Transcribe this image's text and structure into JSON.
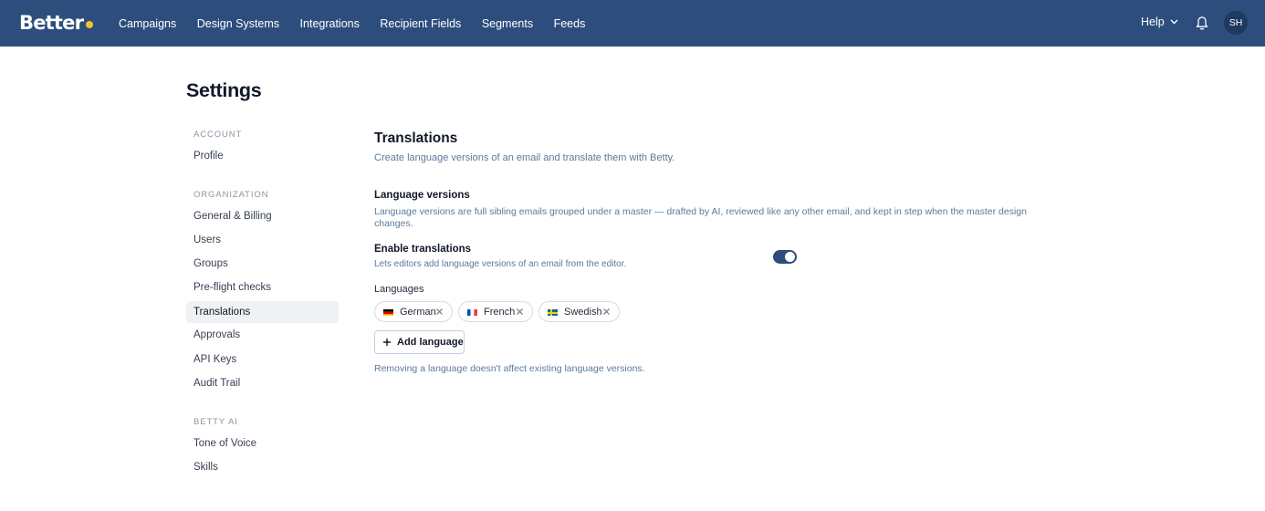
{
  "brand": {
    "name": "Better",
    "dot_color": "#f5c02b",
    "bar_color": "#2d4e7d"
  },
  "nav": [
    {
      "label": "Campaigns"
    },
    {
      "label": "Design Systems"
    },
    {
      "label": "Integrations"
    },
    {
      "label": "Recipient Fields"
    },
    {
      "label": "Segments"
    },
    {
      "label": "Feeds"
    }
  ],
  "header": {
    "help_label": "Help",
    "help_icon": "chevron-down-icon",
    "bell_icon": "bell-icon",
    "avatar_initials": "SH"
  },
  "page": {
    "title": "Settings"
  },
  "sidebar": {
    "account_heading": "ACCOUNT",
    "account_items": [
      {
        "label": "Profile"
      }
    ],
    "organization_heading": "ORGANIZATION",
    "organization_items": [
      {
        "label": "General & Billing"
      },
      {
        "label": "Users"
      },
      {
        "label": "Groups"
      },
      {
        "label": "Pre-flight checks"
      },
      {
        "label": "Translations",
        "active": true
      },
      {
        "label": "Approvals"
      },
      {
        "label": "API Keys"
      },
      {
        "label": "Audit Trail"
      }
    ],
    "ai_heading": "BETTY AI",
    "ai_items": [
      {
        "label": "Tone of Voice"
      },
      {
        "label": "Skills"
      }
    ]
  },
  "main": {
    "title": "Translations",
    "subtitle": "Create language versions of an email and translate them with Betty.",
    "versions_title": "Language versions",
    "versions_desc": "Language versions are full sibling emails grouped under a master — drafted by AI, reviewed like any other email, and kept in step when the master design changes.",
    "enable_title": "Enable translations",
    "enable_desc": "Lets editors add language versions of an email from the editor.",
    "enable_on": true,
    "languages_label": "Languages",
    "languages": [
      {
        "name": "German",
        "flag": "de"
      },
      {
        "name": "French",
        "flag": "fr"
      },
      {
        "name": "Swedish",
        "flag": "se"
      }
    ],
    "add_language_label": "Add language",
    "note": "Removing a language doesn't affect existing language versions."
  }
}
